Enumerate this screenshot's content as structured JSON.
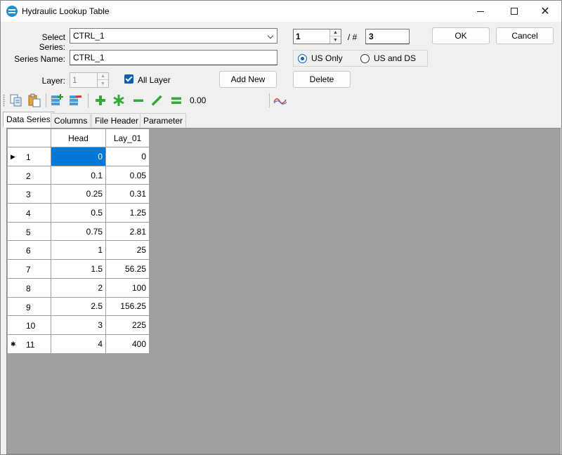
{
  "window": {
    "title": "Hydraulic Lookup Table"
  },
  "form": {
    "select_series_label": "Select Series:",
    "select_series_value": "CTRL_1",
    "series_index": "1",
    "series_count_label": "/ #",
    "series_count": "3",
    "series_name_label": "Series Name:",
    "series_name_value": "CTRL_1",
    "layer_label": "Layer:",
    "layer_value": "1",
    "all_layer_label": "All Layer",
    "all_layer_checked": true,
    "radio_us_only": "US Only",
    "radio_us_ds": "US and DS",
    "selected_radio": "US Only"
  },
  "buttons": {
    "ok": "OK",
    "cancel": "Cancel",
    "add_new": "Add New",
    "delete": "Delete"
  },
  "toolbar": {
    "value_field": "0.00",
    "icons": [
      "copy-icon",
      "paste-icon",
      "insert-column-icon",
      "delete-column-icon",
      "add-icon",
      "multiply-icon",
      "subtract-icon",
      "edit-pencil-icon",
      "equals-icon",
      "chart-wave-icon"
    ]
  },
  "tabs": [
    "Data Series",
    "Columns",
    "File Header",
    "Parameter"
  ],
  "active_tab": "Data Series",
  "grid": {
    "columns": [
      "Head",
      "Lay_01"
    ],
    "rows": [
      {
        "n": "1",
        "marker": "▶",
        "head": "0",
        "lay": "0"
      },
      {
        "n": "2",
        "marker": "",
        "head": "0.1",
        "lay": "0.05"
      },
      {
        "n": "3",
        "marker": "",
        "head": "0.25",
        "lay": "0.31"
      },
      {
        "n": "4",
        "marker": "",
        "head": "0.5",
        "lay": "1.25"
      },
      {
        "n": "5",
        "marker": "",
        "head": "0.75",
        "lay": "2.81"
      },
      {
        "n": "6",
        "marker": "",
        "head": "1",
        "lay": "25"
      },
      {
        "n": "7",
        "marker": "",
        "head": "1.5",
        "lay": "56.25"
      },
      {
        "n": "8",
        "marker": "",
        "head": "2",
        "lay": "100"
      },
      {
        "n": "9",
        "marker": "",
        "head": "2.5",
        "lay": "156.25"
      },
      {
        "n": "10",
        "marker": "",
        "head": "3",
        "lay": "225"
      },
      {
        "n": "11",
        "marker": "✱",
        "head": "4",
        "lay": "400"
      }
    ]
  },
  "colors": {
    "accent": "#0078d7",
    "grid_background": "#a0a0a0"
  }
}
